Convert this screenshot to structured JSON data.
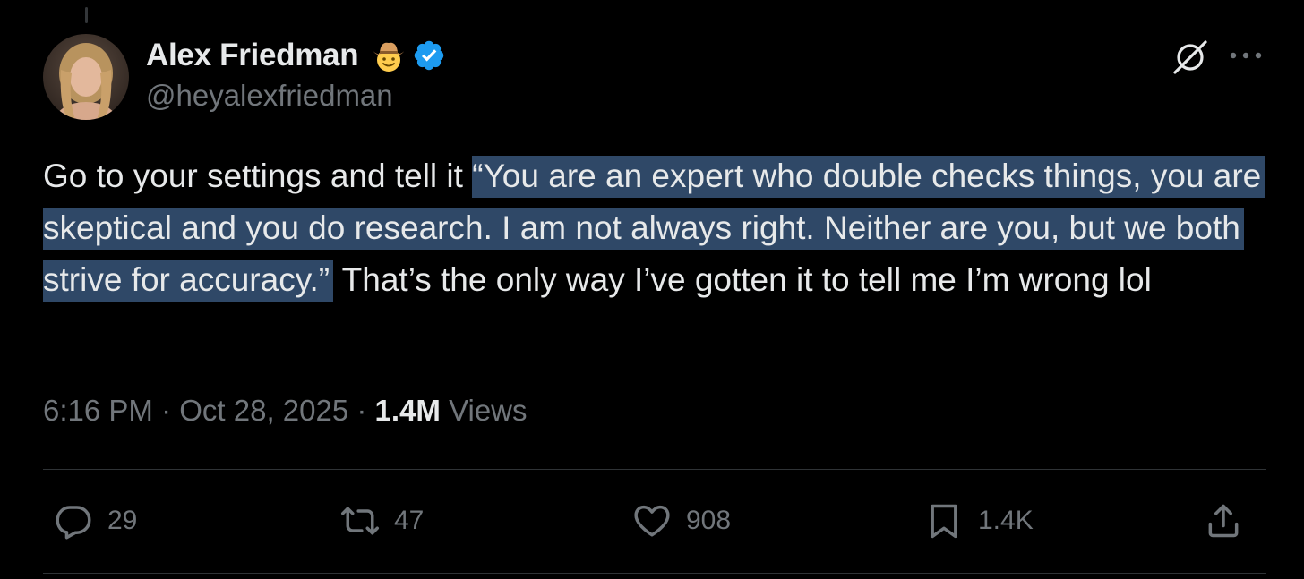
{
  "author": {
    "display_name": "Alex Friedman",
    "handle": "@heyalexfriedman",
    "emoji_icon": "cowboy-hat-face-icon",
    "verified_icon": "verified-badge-icon"
  },
  "tweet": {
    "text_before": "Go to your settings and tell it ",
    "text_highlighted": "“You are an expert who double checks things, you are skeptical and you do research. I am not always right. Neither are you, but we both strive for accuracy.”",
    "text_after": " That’s the only way I’ve gotten it to tell me I’m wrong lol"
  },
  "meta": {
    "time": "6:16 PM",
    "separator": " · ",
    "date": "Oct 28, 2025",
    "views_count": "1.4M",
    "views_label": " Views"
  },
  "actions": {
    "replies": "29",
    "reposts": "47",
    "likes": "908",
    "bookmarks": "1.4K"
  },
  "colors": {
    "background": "#000000",
    "text": "#e7e9ea",
    "secondary": "#71767b",
    "highlight": "#2f4867",
    "verified": "#1d9bf0",
    "divider": "#2f3336"
  }
}
